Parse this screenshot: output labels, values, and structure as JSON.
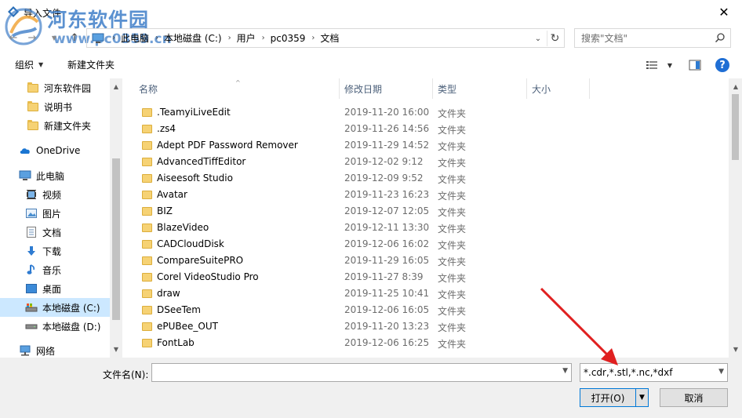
{
  "window": {
    "title": "导入文件",
    "close_label": "✕",
    "watermark_main": "河东软件园",
    "watermark_url": "www.pc0359.cn"
  },
  "address": {
    "crumbs": [
      "此电脑",
      "本地磁盘 (C:)",
      "用户",
      "pc0359",
      "文档"
    ],
    "search_placeholder": "搜索\"文档\""
  },
  "toolbar": {
    "organize_label": "组织",
    "new_folder_label": "新建文件夹",
    "help_label": "?"
  },
  "sidebar": {
    "items": [
      {
        "label": "河东软件园",
        "icon": "folder-icon"
      },
      {
        "label": "说明书",
        "icon": "folder-icon"
      },
      {
        "label": "新建文件夹",
        "icon": "folder-icon"
      },
      {
        "label": "OneDrive",
        "icon": "cloud-icon"
      },
      {
        "label": "此电脑",
        "icon": "computer-icon"
      },
      {
        "label": "视频",
        "icon": "video-icon"
      },
      {
        "label": "图片",
        "icon": "picture-icon"
      },
      {
        "label": "文档",
        "icon": "document-icon"
      },
      {
        "label": "下载",
        "icon": "download-icon"
      },
      {
        "label": "音乐",
        "icon": "music-icon"
      },
      {
        "label": "桌面",
        "icon": "desktop-icon"
      },
      {
        "label": "本地磁盘 (C:)",
        "icon": "drive-c-icon"
      },
      {
        "label": "本地磁盘 (D:)",
        "icon": "drive-d-icon"
      },
      {
        "label": "网络",
        "icon": "network-icon"
      }
    ]
  },
  "filelist": {
    "columns": [
      "名称",
      "修改日期",
      "类型",
      "大小"
    ],
    "rows": [
      {
        "name": ".TeamyiLiveEdit",
        "date": "2019-11-20 16:00",
        "type": "文件夹"
      },
      {
        "name": ".zs4",
        "date": "2019-11-26 14:56",
        "type": "文件夹"
      },
      {
        "name": "Adept PDF Password Remover",
        "date": "2019-11-29 14:52",
        "type": "文件夹"
      },
      {
        "name": "AdvancedTiffEditor",
        "date": "2019-12-02 9:12",
        "type": "文件夹"
      },
      {
        "name": "Aiseesoft Studio",
        "date": "2019-12-09 9:52",
        "type": "文件夹"
      },
      {
        "name": "Avatar",
        "date": "2019-11-23 16:23",
        "type": "文件夹"
      },
      {
        "name": "BIZ",
        "date": "2019-12-07 12:05",
        "type": "文件夹"
      },
      {
        "name": "BlazeVideo",
        "date": "2019-12-11 13:30",
        "type": "文件夹"
      },
      {
        "name": "CADCloudDisk",
        "date": "2019-12-06 16:02",
        "type": "文件夹"
      },
      {
        "name": "CompareSuitePRO",
        "date": "2019-11-29 16:05",
        "type": "文件夹"
      },
      {
        "name": "Corel VideoStudio Pro",
        "date": "2019-11-27 8:39",
        "type": "文件夹"
      },
      {
        "name": "draw",
        "date": "2019-11-25 10:41",
        "type": "文件夹"
      },
      {
        "name": "DSeeTem",
        "date": "2019-12-06 16:05",
        "type": "文件夹"
      },
      {
        "name": "ePUBee_OUT",
        "date": "2019-11-20 13:23",
        "type": "文件夹"
      },
      {
        "name": "FontLab",
        "date": "2019-12-06 16:25",
        "type": "文件夹"
      }
    ]
  },
  "bottom": {
    "filename_label": "文件名(N):",
    "filename_value": "",
    "filter_value": "*.cdr,*.stl,*.nc,*dxf",
    "open_label": "打开(O)",
    "cancel_label": "取消"
  },
  "colors": {
    "accent": "#0078d7",
    "selected_bg": "#cce8ff",
    "folder": "#f6d274",
    "annotation_arrow": "#e02020"
  }
}
